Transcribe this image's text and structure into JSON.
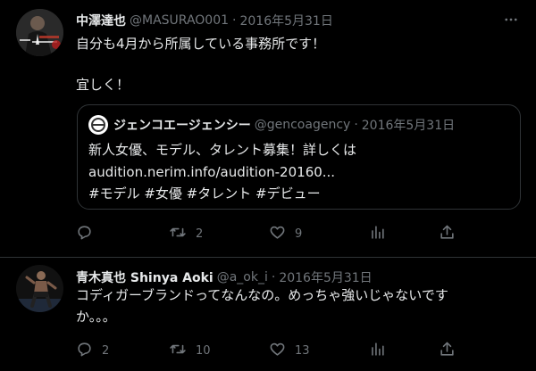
{
  "tweets": [
    {
      "name": "中澤達也",
      "handle": "@MASURAO001",
      "date": "2016年5月31日",
      "text_line1": "自分も4月から所属している事務所です！",
      "text_line2": "宜しく！",
      "quote": {
        "name": "ジェンコエージェンシー",
        "handle": "@gencoagency",
        "date": "2016年5月31日",
        "line1": "新人女優、モデル、タレント募集！詳しくは",
        "line2": "audition.nerim.info/audition-20160...",
        "line3": "#モデル #女優 #タレント #デビュー"
      },
      "counts": {
        "reply": "",
        "retweet": "2",
        "like": "9"
      }
    },
    {
      "name": "青木真也 Shinya Aoki",
      "handle": "@a_ok_i",
      "date": "2016年5月31日",
      "text_line1": "コディガーブランドってなんなの。めっちゃ強いじゃないです",
      "text_line2": "か。。。",
      "counts": {
        "reply": "2",
        "retweet": "10",
        "like": "13"
      }
    }
  ],
  "colors": {
    "background": "#000000",
    "text": "#e7e9ea",
    "secondary": "#71767b",
    "border": "#2f3336"
  },
  "icons": [
    "more-icon",
    "reply-icon",
    "retweet-icon",
    "like-icon",
    "stats-icon",
    "share-icon"
  ]
}
